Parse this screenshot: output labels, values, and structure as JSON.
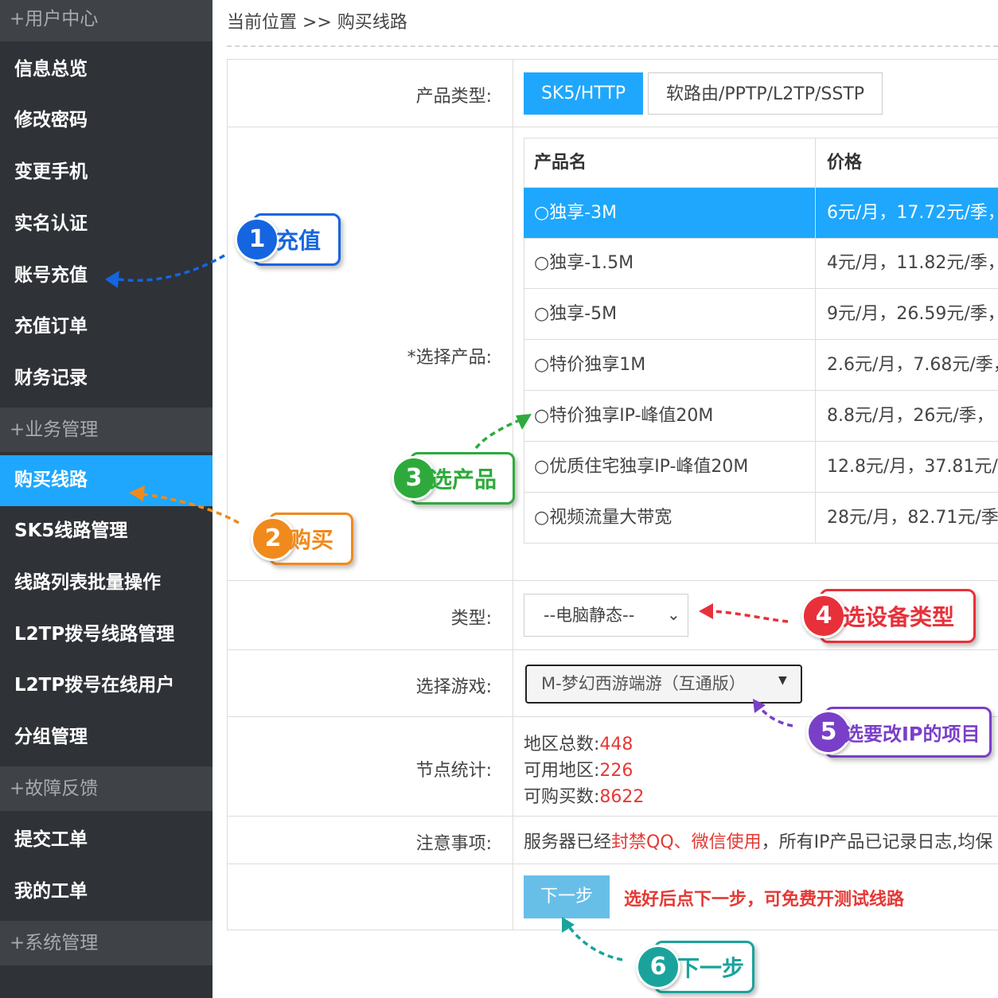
{
  "sidebar": {
    "sections": [
      {
        "label": "+用户中心"
      },
      {
        "label": "+业务管理"
      },
      {
        "label": "+故障反馈"
      },
      {
        "label": "+系统管理"
      }
    ],
    "items": [
      {
        "label": "信息总览"
      },
      {
        "label": "修改密码"
      },
      {
        "label": "变更手机"
      },
      {
        "label": "实名认证"
      },
      {
        "label": "账号充值"
      },
      {
        "label": "充值订单"
      },
      {
        "label": "财务记录"
      },
      {
        "label": "购买线路"
      },
      {
        "label": "SK5线路管理"
      },
      {
        "label": "线路列表批量操作"
      },
      {
        "label": "L2TP拨号线路管理"
      },
      {
        "label": "L2TP拨号在线用户"
      },
      {
        "label": "分组管理"
      },
      {
        "label": "提交工单"
      },
      {
        "label": "我的工单"
      }
    ]
  },
  "breadcrumb": {
    "text": "当前位置 >> 购买线路"
  },
  "form": {
    "product_type_label": "产品类型:",
    "product_types": [
      {
        "label": "SK5/HTTP",
        "selected": true
      },
      {
        "label": "软路由/PPTP/L2TP/SSTP",
        "selected": false
      }
    ],
    "select_product_label": "*选择产品:",
    "table": {
      "headers": [
        "产品名",
        "价格"
      ],
      "rows": [
        {
          "name": "○独享-3M",
          "price": "6元/月，17.72元/季，",
          "selected": true
        },
        {
          "name": "○独享-1.5M",
          "price": "4元/月，11.82元/季，",
          "selected": false
        },
        {
          "name": "○独享-5M",
          "price": "9元/月，26.59元/季，",
          "selected": false
        },
        {
          "name": "○特价独享1M",
          "price": "2.6元/月，7.68元/季，",
          "selected": false
        },
        {
          "name": "○特价独享IP-峰值20M",
          "price": "8.8元/月，26元/季，",
          "selected": false
        },
        {
          "name": "○优质住宅独享IP-峰值20M",
          "price": "12.8元/月，37.81元/",
          "selected": false
        },
        {
          "name": "○视频流量大带宽",
          "price": "28元/月，82.71元/季",
          "selected": false
        }
      ]
    },
    "type_label": "类型:",
    "type_value": "--电脑静态--",
    "game_label": "选择游戏:",
    "game_value": "M-梦幻西游端游（互通版）",
    "node_label": "节点统计:",
    "node_stats": [
      {
        "label": "地区总数:",
        "value": "448"
      },
      {
        "label": "可用地区:",
        "value": "226"
      },
      {
        "label": "可购买数:",
        "value": "8622"
      }
    ],
    "notice_label": "注意事项:",
    "notice": {
      "pre": "服务器已经",
      "red": "封禁QQ、微信使用",
      "post": "，所有IP产品已记录日志,均保"
    },
    "next_button": "下一步",
    "next_tip": "选好后点下一步，可免费开测试线路"
  },
  "callouts": [
    {
      "num": "1",
      "text": "充值",
      "color": "#1565e0"
    },
    {
      "num": "2",
      "text": "购买",
      "color": "#f08a1c"
    },
    {
      "num": "3",
      "text": "选产品",
      "color": "#2eaa3c"
    },
    {
      "num": "4",
      "text": "选设备类型",
      "color": "#e8303a"
    },
    {
      "num": "5",
      "text": "选要改IP的项目",
      "color": "#7a3fc8"
    },
    {
      "num": "6",
      "text": "下一步",
      "color": "#1aa39c"
    }
  ]
}
